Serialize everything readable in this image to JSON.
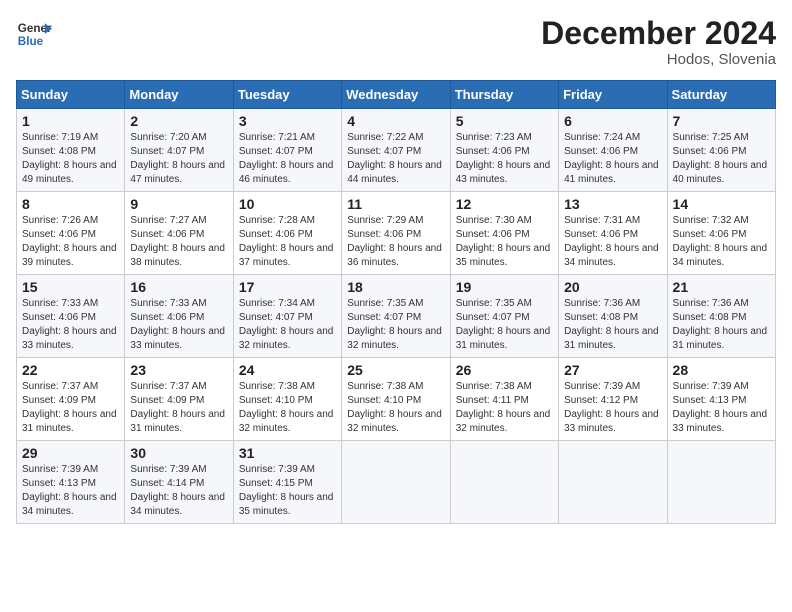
{
  "header": {
    "logo_line1": "General",
    "logo_line2": "Blue",
    "month": "December 2024",
    "location": "Hodos, Slovenia"
  },
  "days_of_week": [
    "Sunday",
    "Monday",
    "Tuesday",
    "Wednesday",
    "Thursday",
    "Friday",
    "Saturday"
  ],
  "weeks": [
    [
      {
        "day": "1",
        "sunrise": "7:19 AM",
        "sunset": "4:08 PM",
        "daylight": "8 hours and 49 minutes."
      },
      {
        "day": "2",
        "sunrise": "7:20 AM",
        "sunset": "4:07 PM",
        "daylight": "8 hours and 47 minutes."
      },
      {
        "day": "3",
        "sunrise": "7:21 AM",
        "sunset": "4:07 PM",
        "daylight": "8 hours and 46 minutes."
      },
      {
        "day": "4",
        "sunrise": "7:22 AM",
        "sunset": "4:07 PM",
        "daylight": "8 hours and 44 minutes."
      },
      {
        "day": "5",
        "sunrise": "7:23 AM",
        "sunset": "4:06 PM",
        "daylight": "8 hours and 43 minutes."
      },
      {
        "day": "6",
        "sunrise": "7:24 AM",
        "sunset": "4:06 PM",
        "daylight": "8 hours and 41 minutes."
      },
      {
        "day": "7",
        "sunrise": "7:25 AM",
        "sunset": "4:06 PM",
        "daylight": "8 hours and 40 minutes."
      }
    ],
    [
      {
        "day": "8",
        "sunrise": "7:26 AM",
        "sunset": "4:06 PM",
        "daylight": "8 hours and 39 minutes."
      },
      {
        "day": "9",
        "sunrise": "7:27 AM",
        "sunset": "4:06 PM",
        "daylight": "8 hours and 38 minutes."
      },
      {
        "day": "10",
        "sunrise": "7:28 AM",
        "sunset": "4:06 PM",
        "daylight": "8 hours and 37 minutes."
      },
      {
        "day": "11",
        "sunrise": "7:29 AM",
        "sunset": "4:06 PM",
        "daylight": "8 hours and 36 minutes."
      },
      {
        "day": "12",
        "sunrise": "7:30 AM",
        "sunset": "4:06 PM",
        "daylight": "8 hours and 35 minutes."
      },
      {
        "day": "13",
        "sunrise": "7:31 AM",
        "sunset": "4:06 PM",
        "daylight": "8 hours and 34 minutes."
      },
      {
        "day": "14",
        "sunrise": "7:32 AM",
        "sunset": "4:06 PM",
        "daylight": "8 hours and 34 minutes."
      }
    ],
    [
      {
        "day": "15",
        "sunrise": "7:33 AM",
        "sunset": "4:06 PM",
        "daylight": "8 hours and 33 minutes."
      },
      {
        "day": "16",
        "sunrise": "7:33 AM",
        "sunset": "4:06 PM",
        "daylight": "8 hours and 33 minutes."
      },
      {
        "day": "17",
        "sunrise": "7:34 AM",
        "sunset": "4:07 PM",
        "daylight": "8 hours and 32 minutes."
      },
      {
        "day": "18",
        "sunrise": "7:35 AM",
        "sunset": "4:07 PM",
        "daylight": "8 hours and 32 minutes."
      },
      {
        "day": "19",
        "sunrise": "7:35 AM",
        "sunset": "4:07 PM",
        "daylight": "8 hours and 31 minutes."
      },
      {
        "day": "20",
        "sunrise": "7:36 AM",
        "sunset": "4:08 PM",
        "daylight": "8 hours and 31 minutes."
      },
      {
        "day": "21",
        "sunrise": "7:36 AM",
        "sunset": "4:08 PM",
        "daylight": "8 hours and 31 minutes."
      }
    ],
    [
      {
        "day": "22",
        "sunrise": "7:37 AM",
        "sunset": "4:09 PM",
        "daylight": "8 hours and 31 minutes."
      },
      {
        "day": "23",
        "sunrise": "7:37 AM",
        "sunset": "4:09 PM",
        "daylight": "8 hours and 31 minutes."
      },
      {
        "day": "24",
        "sunrise": "7:38 AM",
        "sunset": "4:10 PM",
        "daylight": "8 hours and 32 minutes."
      },
      {
        "day": "25",
        "sunrise": "7:38 AM",
        "sunset": "4:10 PM",
        "daylight": "8 hours and 32 minutes."
      },
      {
        "day": "26",
        "sunrise": "7:38 AM",
        "sunset": "4:11 PM",
        "daylight": "8 hours and 32 minutes."
      },
      {
        "day": "27",
        "sunrise": "7:39 AM",
        "sunset": "4:12 PM",
        "daylight": "8 hours and 33 minutes."
      },
      {
        "day": "28",
        "sunrise": "7:39 AM",
        "sunset": "4:13 PM",
        "daylight": "8 hours and 33 minutes."
      }
    ],
    [
      {
        "day": "29",
        "sunrise": "7:39 AM",
        "sunset": "4:13 PM",
        "daylight": "8 hours and 34 minutes."
      },
      {
        "day": "30",
        "sunrise": "7:39 AM",
        "sunset": "4:14 PM",
        "daylight": "8 hours and 34 minutes."
      },
      {
        "day": "31",
        "sunrise": "7:39 AM",
        "sunset": "4:15 PM",
        "daylight": "8 hours and 35 minutes."
      },
      null,
      null,
      null,
      null
    ]
  ],
  "labels": {
    "sunrise": "Sunrise:",
    "sunset": "Sunset:",
    "daylight": "Daylight:"
  }
}
